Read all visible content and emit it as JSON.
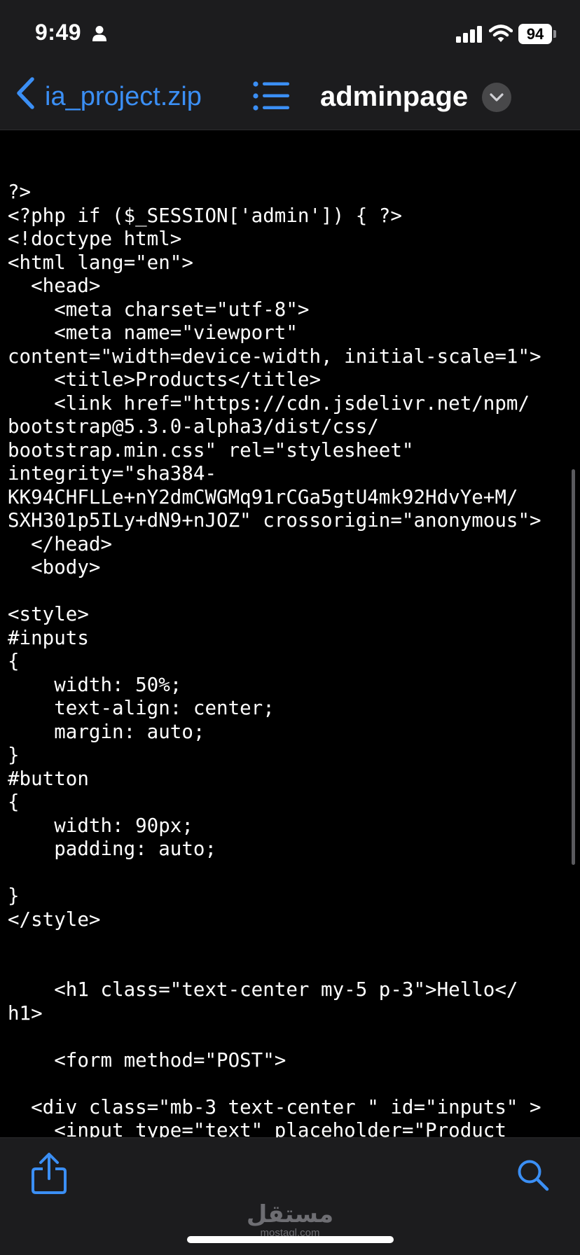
{
  "status_bar": {
    "time": "9:49",
    "battery": "94",
    "icons": [
      "person-icon",
      "signal-icon",
      "wifi-icon",
      "battery-icon"
    ]
  },
  "nav": {
    "back_label": "ia_project.zip",
    "title": "adminpage",
    "icons": [
      "chevron-left-icon",
      "list-icon",
      "chevron-down-icon"
    ],
    "accent_color": "#3b8ff5"
  },
  "code": {
    "lines": [
      "?>",
      "<?php if ($_SESSION['admin']) { ?>",
      "<!doctype html>",
      "<html lang=\"en\">",
      "  <head>",
      "    <meta charset=\"utf-8\">",
      "    <meta name=\"viewport\"",
      "content=\"width=device-width, initial-scale=1\">",
      "    <title>Products</title>",
      "    <link href=\"https://cdn.jsdelivr.net/npm/",
      "bootstrap@5.3.0-alpha3/dist/css/",
      "bootstrap.min.css\" rel=\"stylesheet\"",
      "integrity=\"sha384-",
      "KK94CHFLLe+nY2dmCWGMq91rCGa5gtU4mk92HdvYe+M/",
      "SXH301p5ILy+dN9+nJOZ\" crossorigin=\"anonymous\">",
      "  </head>",
      "  <body>",
      "",
      "<style>",
      "#inputs",
      "{",
      "    width: 50%;",
      "    text-align: center;",
      "    margin: auto;",
      "}",
      "#button",
      "{",
      "    width: 90px;",
      "    padding: auto;",
      "",
      "}",
      "</style>",
      "",
      "",
      "    <h1 class=\"text-center my-5 p-3\">Hello</",
      "h1>",
      "",
      "    <form method=\"POST\">",
      "",
      "  <div class=\"mb-3 text-center \" id=\"inputs\" >",
      "    <input type=\"text\" placeholder=\"Product"
    ]
  },
  "toolbar": {
    "icons": [
      "share-icon",
      "search-icon"
    ],
    "accent_color": "#3b8ff5"
  },
  "watermark": {
    "arabic": "مستقل",
    "latin": "mostaql.com"
  }
}
